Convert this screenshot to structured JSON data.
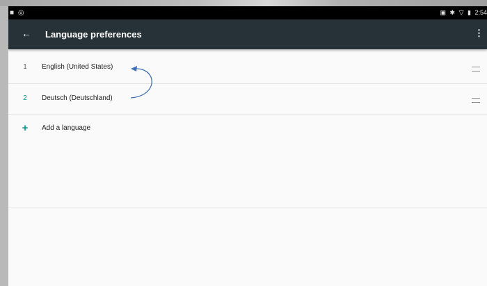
{
  "status_bar": {
    "left_icons": [
      "video-record-icon",
      "camera-icon"
    ],
    "right_icons": [
      "cast-icon",
      "bluetooth-icon",
      "wifi-icon",
      "battery-icon"
    ],
    "time": "2:54"
  },
  "app_bar": {
    "title": "Language preferences",
    "back_icon": "arrow-back-icon",
    "menu_icon": "more-vert-icon"
  },
  "languages": [
    {
      "index": "1",
      "name": "English (United States)"
    },
    {
      "index": "2",
      "name": "Deutsch (Deutschland)"
    }
  ],
  "add_language": {
    "icon": "+",
    "label": "Add a language"
  },
  "colors": {
    "app_bar": "#263238",
    "accent": "#009688",
    "arrow": "#3f6fb5"
  }
}
